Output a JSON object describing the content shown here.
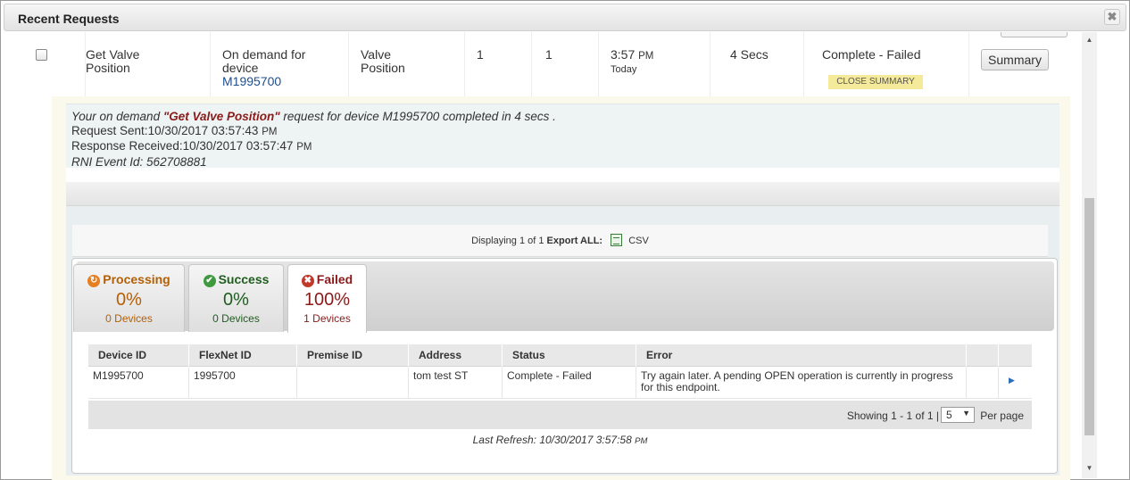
{
  "dialog": {
    "title": "Recent Requests",
    "close_glyph": "✖"
  },
  "request_row": {
    "name": "Get Valve Position",
    "name_line1": "Get Valve",
    "name_line2": "Position",
    "source_line1": "On demand for",
    "source_line2": "device",
    "device_link": "M1995700",
    "attribute_line1": "Valve",
    "attribute_line2": "Position",
    "count1": "1",
    "count2": "1",
    "time": "3:57",
    "time_ampm": "PM",
    "time_day": "Today",
    "duration": "4 Secs",
    "status": "Complete - Failed",
    "summary_button": "Summary",
    "close_summary": "CLOSE SUMMARY"
  },
  "message": {
    "prefix": "Your on demand ",
    "request_name": "\"Get Valve Position\"",
    "suffix": " request for device M1995700 completed in 4 secs .",
    "request_sent_label": "Request Sent:",
    "request_sent_value": "10/30/2017 03:57:43",
    "request_sent_ampm": "PM",
    "response_label": "Response Received:",
    "response_value": "10/30/2017 03:57:47",
    "response_ampm": "PM",
    "event_label": "RNI Event Id: ",
    "event_value": "562708881"
  },
  "export_bar": {
    "displaying": "Displaying 1 of 1",
    "export_all": "Export ALL:",
    "csv": "CSV"
  },
  "tabs": [
    {
      "label": "Processing",
      "percent": "0%",
      "count": "0 Devices",
      "color": "#b45f06",
      "icon": "refresh-icon",
      "glyph": "↻",
      "icon_bg": "#e67e22"
    },
    {
      "label": "Success",
      "percent": "0%",
      "count": "0 Devices",
      "color": "#1e5e1e",
      "icon": "check-icon",
      "glyph": "✔",
      "icon_bg": "#3f9a3f"
    },
    {
      "label": "Failed",
      "percent": "100%",
      "count": "1 Devices",
      "color": "#8b1a1a",
      "icon": "error-icon",
      "glyph": "✖",
      "icon_bg": "#c0392b"
    }
  ],
  "grid": {
    "columns": [
      "Device ID",
      "FlexNet ID",
      "Premise ID",
      "Address",
      "Status",
      "Error"
    ],
    "rows": [
      {
        "device_id": "M1995700",
        "flexnet_id": "1995700",
        "premise_id": "",
        "address": "tom test ST",
        "status": "Complete - Failed",
        "error": "Try again later. A pending OPEN operation is currently in progress for this endpoint."
      }
    ],
    "showing": "Showing 1 - 1 of 1 |",
    "per_page_value": "5",
    "per_page_label": "Per page"
  },
  "last_refresh": {
    "label": "Last Refresh: ",
    "value": "10/30/2017 3:57:58",
    "ampm": "PM"
  }
}
